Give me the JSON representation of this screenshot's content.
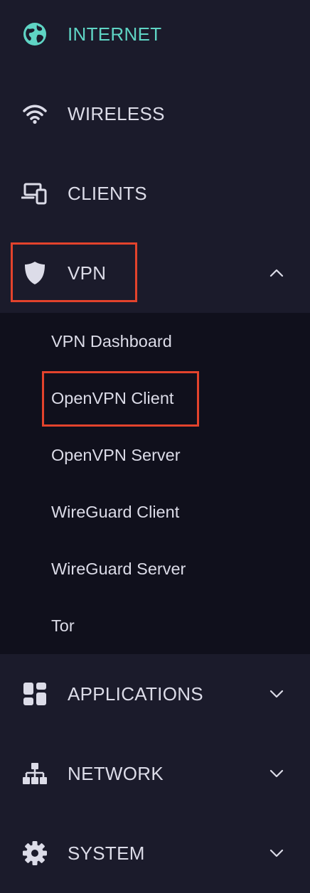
{
  "nav": {
    "internet": {
      "label": "INTERNET",
      "icon": "globe-icon",
      "active": true
    },
    "wireless": {
      "label": "WIRELESS",
      "icon": "wifi-icon"
    },
    "clients": {
      "label": "CLIENTS",
      "icon": "devices-icon"
    },
    "vpn": {
      "label": "VPN",
      "icon": "shield-icon",
      "expanded": true
    },
    "applications": {
      "label": "APPLICATIONS",
      "icon": "apps-grid-icon"
    },
    "network": {
      "label": "NETWORK",
      "icon": "network-tree-icon"
    },
    "system": {
      "label": "SYSTEM",
      "icon": "gear-icon"
    }
  },
  "vpn_submenu": {
    "items": [
      {
        "label": "VPN Dashboard"
      },
      {
        "label": "OpenVPN Client"
      },
      {
        "label": "OpenVPN Server"
      },
      {
        "label": "WireGuard Client"
      },
      {
        "label": "WireGuard Server"
      },
      {
        "label": "Tor"
      }
    ]
  },
  "colors": {
    "background": "#1b1b2b",
    "submenu_background": "#10101c",
    "active_accent": "#5fd4c4",
    "text": "#dcdce8",
    "highlight": "#e3432c"
  }
}
